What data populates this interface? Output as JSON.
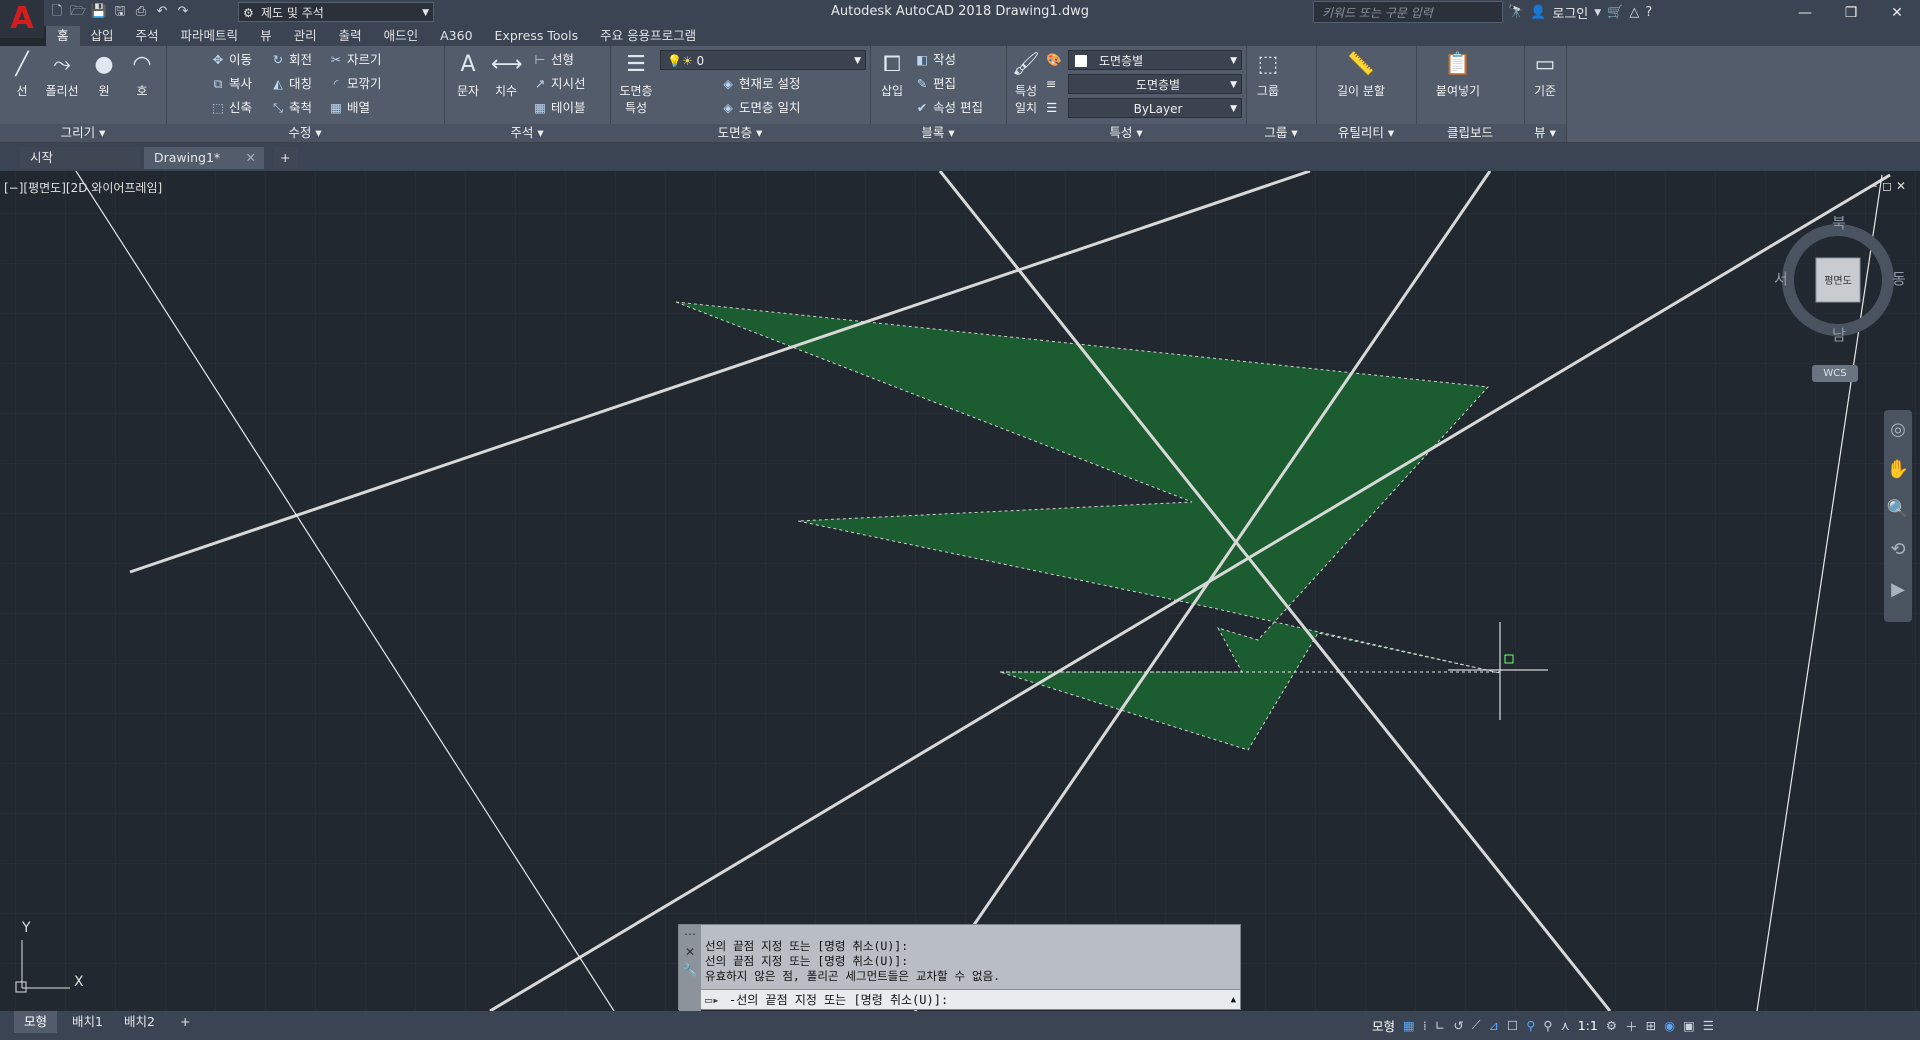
{
  "app": {
    "logo": "A",
    "title": "Autodesk AutoCAD 2018    Drawing1.dwg",
    "workspace": "제도 및 주석",
    "search_placeholder": "키워드 또는 구문 입력",
    "login": "로그인"
  },
  "ribbon_tabs": [
    "홈",
    "삽입",
    "주석",
    "파라메트릭",
    "뷰",
    "관리",
    "출력",
    "애드인",
    "A360",
    "Express Tools",
    "주요 응용프로그램"
  ],
  "panels": {
    "draw": {
      "title": "그리기 ▾",
      "line": "선",
      "polyline": "폴리선",
      "circle": "원",
      "arc": "호"
    },
    "modify": {
      "title": "수정 ▾",
      "move": "이동",
      "rotate": "회전",
      "trim": "자르기",
      "copy": "복사",
      "mirror": "대칭",
      "fillet": "모깎기",
      "stretch": "신축",
      "scale": "축척",
      "array": "배열"
    },
    "annotation": {
      "title": "주석 ▾",
      "text": "문자",
      "dimension": "치수",
      "linear": "선형",
      "leader": "지시선",
      "table": "테이블"
    },
    "layers": {
      "title": "도면층 ▾",
      "props": "도면층\n특성",
      "current_layer": "0",
      "make_current": "현재로 설정",
      "match_layer": "도면층 일치"
    },
    "block": {
      "title": "블록 ▾",
      "insert": "삽입",
      "create": "작성",
      "edit": "편집",
      "edit_attr": "속성 편집"
    },
    "properties": {
      "title": "특성 ▾",
      "match": "특성\n일치",
      "color": "도면층별",
      "linetype": "도면층별",
      "lineweight": "ByLayer"
    },
    "groups": {
      "title": "그룹 ▾",
      "group": "그룹"
    },
    "utilities": {
      "title": "유틸리티 ▾",
      "measure": "길이 분할"
    },
    "clipboard": {
      "title": "클립보드",
      "paste": "붙여넣기"
    },
    "view": {
      "title": "뷰 ▾",
      "base": "기준"
    }
  },
  "doc_tabs": {
    "start": "시작",
    "drawing": "Drawing1*",
    "add": "+"
  },
  "viewport": {
    "label": "[−][평면도][2D 와이어프레임]",
    "controls": "−◻✕"
  },
  "viewcube": {
    "north": "북",
    "south": "남",
    "east": "동",
    "west": "서",
    "face": "평면도",
    "wcs": "WCS"
  },
  "ucs": {
    "x": "X",
    "y": "Y"
  },
  "command": {
    "history": [
      "선의 끝점 지정 또는 [명령 취소(U)]:",
      "선의 끝점 지정 또는 [명령 취소(U)]:",
      "유효하지 않은 점, 폴리곤 세그먼트들은 교차할 수 없음."
    ],
    "prompt": "-선의 끝점 지정 또는 [명령 취소(U)]:"
  },
  "layout_tabs": [
    "모형",
    "배치1",
    "배치2"
  ],
  "status": {
    "model": "모형",
    "scale": "1:1"
  },
  "colors": {
    "canvas": "#212830",
    "hatch": "#1b5c30",
    "ribbon": "#525c6b",
    "titlebar": "#3b4453",
    "accent": "#d21e1e"
  }
}
